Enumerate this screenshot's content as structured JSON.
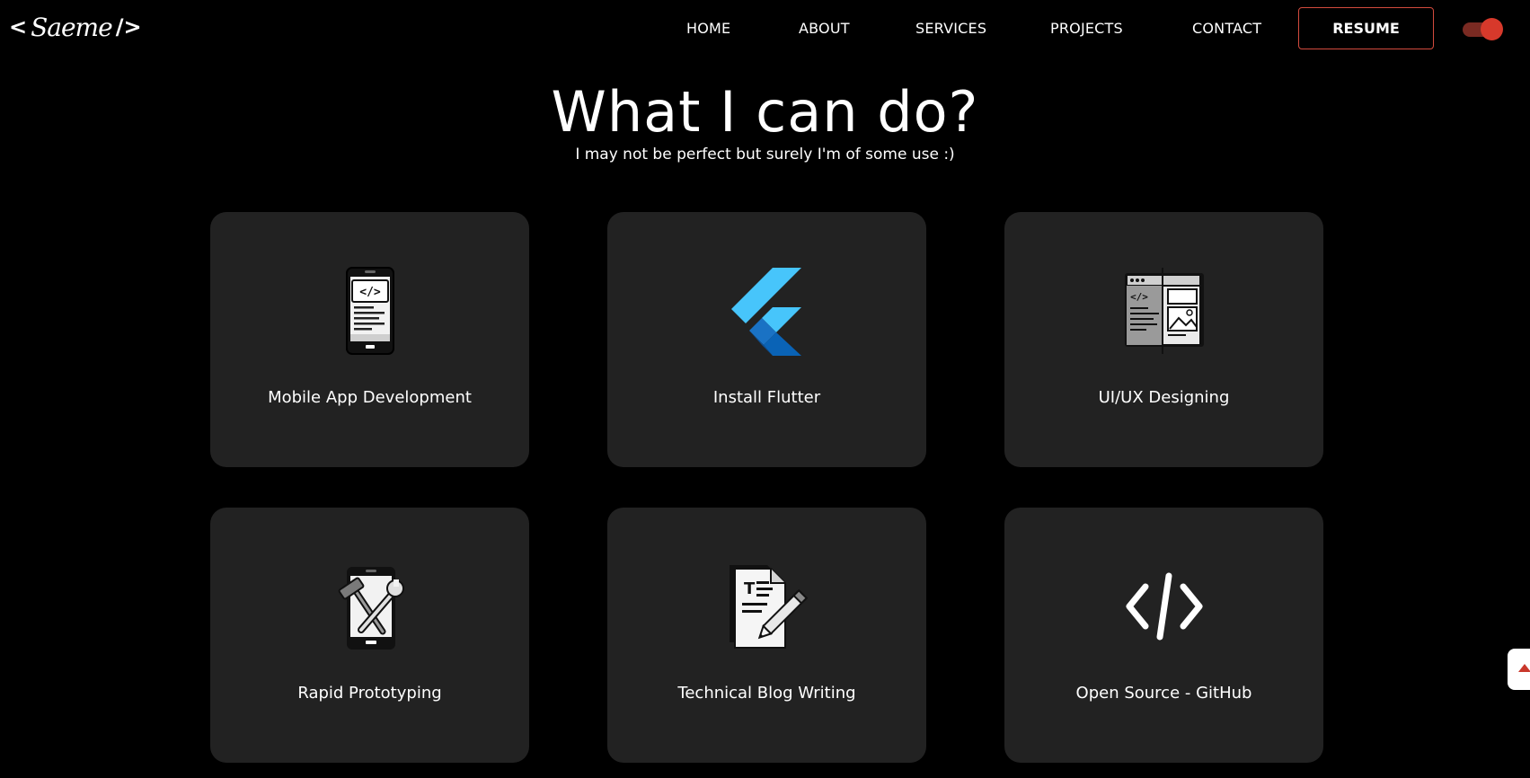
{
  "logo": {
    "left_bracket": "<",
    "name": "Saeme",
    "right_bracket": "/>"
  },
  "nav": {
    "items": [
      {
        "label": "HOME"
      },
      {
        "label": "ABOUT"
      },
      {
        "label": "SERVICES"
      },
      {
        "label": "PROJECTS"
      },
      {
        "label": "CONTACT"
      }
    ],
    "resume_label": "RESUME",
    "theme_toggle_on": true
  },
  "colors": {
    "background": "#000000",
    "card": "#222222",
    "accent": "#d7392b",
    "flutter_light": "#47c5fb",
    "flutter_dark": "#0a63b6"
  },
  "section": {
    "title": "What I can do?",
    "subtitle": "I may not be perfect but surely I'm of some use :)"
  },
  "services": [
    {
      "label": "Mobile App Development",
      "icon": "mobile-code-icon"
    },
    {
      "label": "Install Flutter",
      "icon": "flutter-icon"
    },
    {
      "label": "UI/UX Designing",
      "icon": "ui-ux-design-icon"
    },
    {
      "label": "Rapid Prototyping",
      "icon": "prototyping-tools-icon"
    },
    {
      "label": "Technical Blog Writing",
      "icon": "blog-writing-icon"
    },
    {
      "label": "Open Source - GitHub",
      "icon": "code-icon"
    }
  ]
}
